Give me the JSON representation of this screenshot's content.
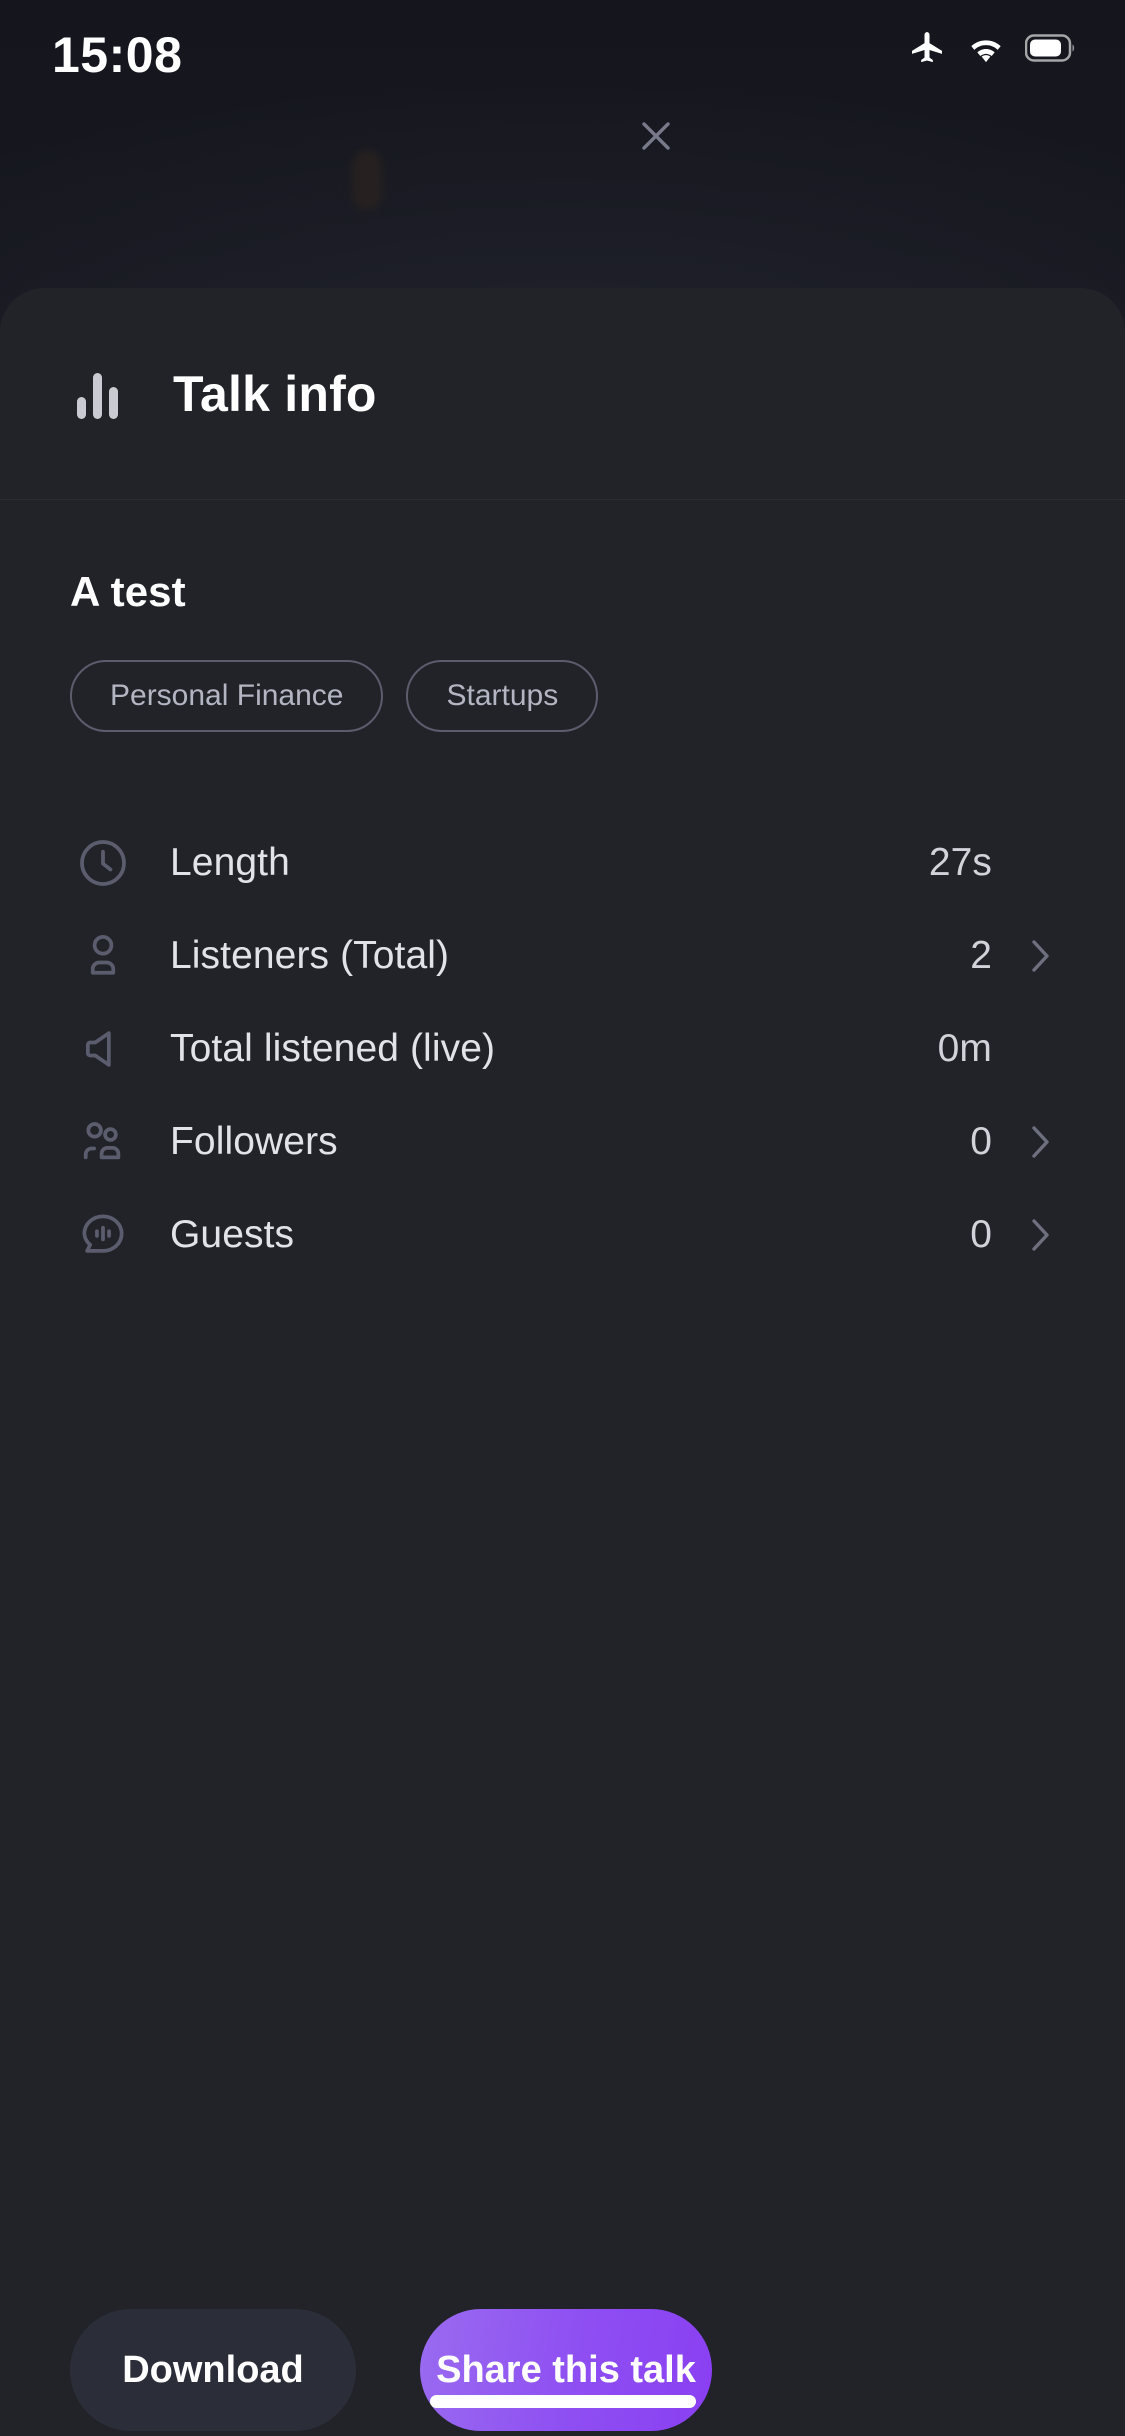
{
  "status_bar": {
    "time": "15:08",
    "icons": [
      "airplane-mode-icon",
      "wifi-icon",
      "battery-icon"
    ]
  },
  "close_button": {
    "icon": "close-icon",
    "label": "Close"
  },
  "sheet": {
    "header": {
      "icon": "bar-chart-icon",
      "title": "Talk info"
    },
    "talk": {
      "title": "A test",
      "tags": [
        {
          "label": "Personal Finance"
        },
        {
          "label": "Startups"
        }
      ]
    },
    "stats": [
      {
        "icon": "clock-icon",
        "label": "Length",
        "value": "27s",
        "has_chevron": false
      },
      {
        "icon": "person-icon",
        "label": "Listeners (Total)",
        "value": "2",
        "has_chevron": true
      },
      {
        "icon": "megaphone-icon",
        "label": "Total listened (live)",
        "value": "0m",
        "has_chevron": false
      },
      {
        "icon": "people-icon",
        "label": "Followers",
        "value": "0",
        "has_chevron": true
      },
      {
        "icon": "speech-bubble-voice-icon",
        "label": "Guests",
        "value": "0",
        "has_chevron": true
      }
    ],
    "footer": {
      "download_label": "Download",
      "share_label": "Share this talk"
    }
  },
  "colors": {
    "background": "#15161d",
    "sheet": "#212329",
    "accent_purple_start": "#9a6bf0",
    "accent_purple_end": "#8a3ff2",
    "secondary_button": "#2b2e38",
    "text_primary": "#ffffff",
    "text_secondary": "#d2d3da",
    "icon_muted": "#5b5d6e"
  }
}
